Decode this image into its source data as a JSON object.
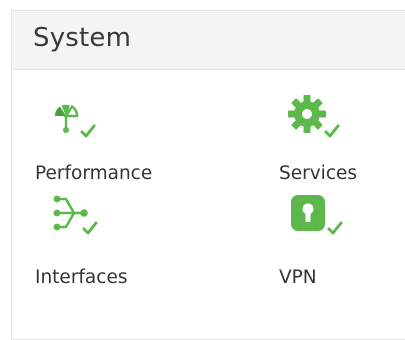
{
  "panel": {
    "title": "System"
  },
  "tiles": [
    {
      "label": "Performance",
      "icon": "performance-gauge-icon"
    },
    {
      "label": "Services",
      "icon": "gear-icon"
    },
    {
      "label": "Interfaces",
      "icon": "network-interfaces-icon"
    },
    {
      "label": "VPN",
      "icon": "lock-icon"
    }
  ],
  "colors": {
    "accent": "#5cb84a",
    "accent_dark": "#44a33a",
    "text": "#333333",
    "header_bg": "#f4f4f4"
  }
}
